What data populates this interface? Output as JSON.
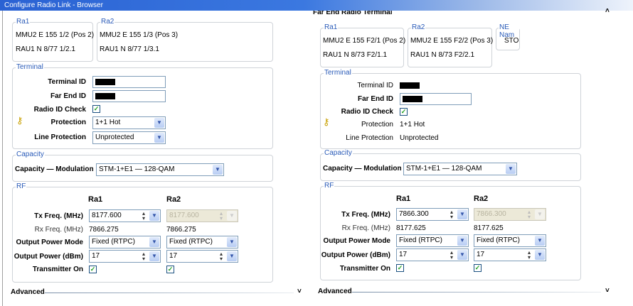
{
  "window": {
    "title": "Configure Radio Link - Browser"
  },
  "near": {
    "ra1": {
      "legend": "Ra1",
      "mmu": "MMU2 E 155 1/2  (Pos 2)",
      "rau": "RAU1 N 8/77 1/2.1"
    },
    "ra2": {
      "legend": "Ra2",
      "mmu": "MMU2 E 155 1/3  (Pos 3)",
      "rau": "RAU1 N 8/77 1/3.1"
    },
    "terminal": {
      "legend": "Terminal",
      "terminal_id_label": "Terminal ID",
      "far_end_id_label": "Far End ID",
      "radio_id_check_label": "Radio ID Check",
      "radio_id_check": true,
      "protection_label": "Protection",
      "protection": "1+1 Hot",
      "line_protection_label": "Line Protection",
      "line_protection": "Unprotected"
    },
    "capacity": {
      "legend": "Capacity",
      "label": "Capacity — Modulation",
      "value": "STM-1+E1 — 128-QAM"
    },
    "rf": {
      "legend": "RF",
      "col1": "Ra1",
      "col2": "Ra2",
      "tx_label": "Tx Freq. (MHz)",
      "rx_label": "Rx Freq. (MHz)",
      "mode_label": "Output Power Mode",
      "power_label": "Output Power (dBm)",
      "tx_on_label": "Transmitter On",
      "ra1": {
        "tx": "8177.600",
        "rx": "7866.275",
        "mode": "Fixed (RTPC)",
        "power": "17",
        "tx_on": true
      },
      "ra2": {
        "tx": "8177.600",
        "rx": "7866.275",
        "mode": "Fixed (RTPC)",
        "power": "17",
        "tx_on": true
      }
    },
    "advanced": "Advanced"
  },
  "far": {
    "title": "Far End Radio Terminal",
    "ra1": {
      "legend": "Ra1",
      "mmu": "MMU2 E 155 F2/1  (Pos 2)",
      "rau": "RAU1 N 8/73 F2/1.1"
    },
    "ra2": {
      "legend": "Ra2",
      "mmu": "MMU2 E 155 F2/2  (Pos 3)",
      "rau": "RAU1 N 8/73 F2/2.1"
    },
    "ne": {
      "legend": "NE Nam",
      "value": "STO"
    },
    "terminal": {
      "legend": "Terminal",
      "terminal_id_label": "Terminal ID",
      "far_end_id_label": "Far End ID",
      "radio_id_check_label": "Radio ID Check",
      "radio_id_check": true,
      "protection_label": "Protection",
      "protection": "1+1 Hot",
      "line_protection_label": "Line Protection",
      "line_protection": "Unprotected"
    },
    "capacity": {
      "legend": "Capacity",
      "label": "Capacity — Modulation",
      "value": "STM-1+E1 — 128-QAM"
    },
    "rf": {
      "legend": "RF",
      "col1": "Ra1",
      "col2": "Ra2",
      "tx_label": "Tx Freq. (MHz)",
      "rx_label": "Rx Freq. (MHz)",
      "mode_label": "Output Power Mode",
      "power_label": "Output Power (dBm)",
      "tx_on_label": "Transmitter On",
      "ra1": {
        "tx": "7866.300",
        "rx": "8177.625",
        "mode": "Fixed (RTPC)",
        "power": "17",
        "tx_on": true
      },
      "ra2": {
        "tx": "7866.300",
        "rx": "8177.625",
        "mode": "Fixed (RTPC)",
        "power": "17",
        "tx_on": true
      }
    },
    "advanced": "Advanced"
  },
  "icons": {
    "key": "key-icon",
    "check": "checkmark-icon",
    "dropdown": "chevron-down-icon",
    "collapse": "chevron-up-icon"
  }
}
